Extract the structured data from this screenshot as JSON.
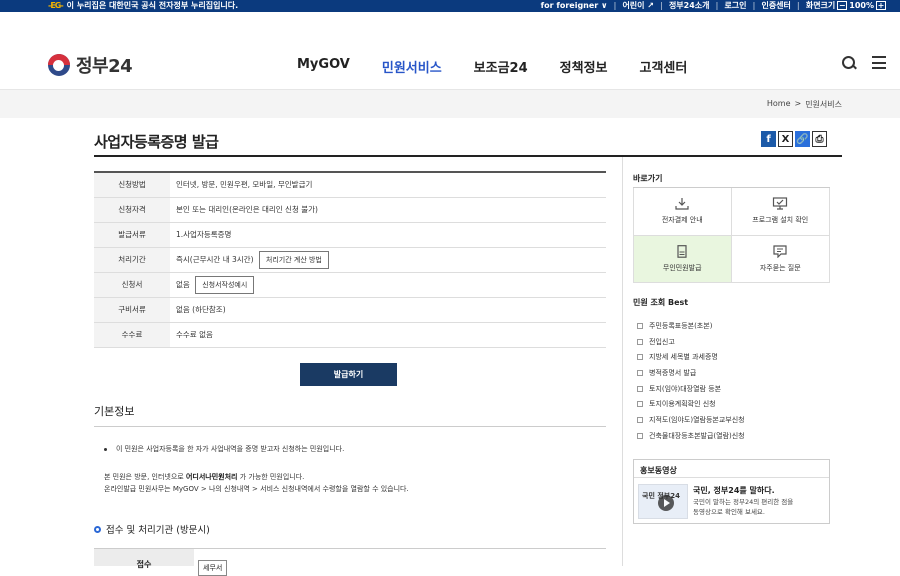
{
  "topbar": {
    "gov_mark": "-EG-",
    "gov_notice": "이 누리집은 대한민국 공식 전자정부 누리집입니다.",
    "links": [
      "for foreigner ∨",
      "어린이 ↗",
      "정부24소개",
      "로그인",
      "인증센터",
      "화면크기"
    ],
    "zoom_minus": "−",
    "zoom_value": "100%",
    "zoom_plus": "+"
  },
  "header": {
    "logo_text": "정부24",
    "nav": [
      "MyGOV",
      "민원서비스",
      "보조금24",
      "정책정보",
      "고객센터"
    ],
    "active_nav": "민원서비스"
  },
  "breadcrumb": {
    "home": "Home",
    "sep": ">",
    "current": "민원서비스"
  },
  "page": {
    "title": "사업자등록증명 발급",
    "share": {
      "facebook": "f",
      "x": "X",
      "link": "🔗",
      "print": "⎙"
    }
  },
  "info_rows": [
    {
      "key": "신청방법",
      "value": "인터넷, 방문, 민원우편, 모바일, 무인발급기"
    },
    {
      "key": "신청자격",
      "value": "본인 또는 대리인(온라인은 대리인 신청 불가)"
    },
    {
      "key": "발급서류",
      "value": "1.사업자등록증명"
    },
    {
      "key": "처리기간",
      "value": "즉시(근무시간 내 3시간)",
      "button": "처리기간 계산 방법"
    },
    {
      "key": "신청서",
      "value": "없음",
      "button": "신청서작성예시"
    },
    {
      "key": "구비서류",
      "value": "없음 (하단참조)"
    },
    {
      "key": "수수료",
      "value": "수수료 없음"
    }
  ],
  "issue_button": "발급하기",
  "basic": {
    "title": "기본정보",
    "desc1": "이 민원은 사업자등록을 한 자가 사업내역을 증명 받고자 신청하는 민원입니다.",
    "desc2_pre": "본 민원은 방문, 인터넷으로 ",
    "desc2_bold": "어디서나민원처리",
    "desc2_post": " 가 가능한 민원입니다.",
    "desc3": "온라인발급 민원사무는 MyGOV > 나의 신청내역 > 서비스 신청내역에서 수령할을 열람할 수 있습니다."
  },
  "accept": {
    "title": "접수 및 처리기관 (방문시)",
    "key": "접수",
    "tag": "세무서"
  },
  "sidebar": {
    "quick_title": "바로가기",
    "quick": [
      {
        "label": "전자결제 안내",
        "icon": "download-icon"
      },
      {
        "label": "프로그램 설치 확인",
        "icon": "monitor-icon"
      },
      {
        "label": "무인민원발급",
        "icon": "kiosk-icon"
      },
      {
        "label": "자주묻는 질문",
        "icon": "chat-icon"
      }
    ],
    "best_title": "민원 조회 Best",
    "best": [
      "주민등록표등본(초본)",
      "전입신고",
      "지방세 세목별 과세증명",
      "병적증명서 발급",
      "토지(임야)대장열람 등본",
      "토지이용계획확인 신청",
      "지적도(임야도)열람등본교부신청",
      "건축물대장등초본발급(열람)신청"
    ],
    "promo_title": "홍보동영상",
    "promo_thumb_text": "국민 정부24",
    "promo_head": "국민, 정부24를 말하다.",
    "promo_desc1": "국민이 말하는 정부24의 편리한 점을",
    "promo_desc2": "동영상으로 확인해 보세요."
  }
}
